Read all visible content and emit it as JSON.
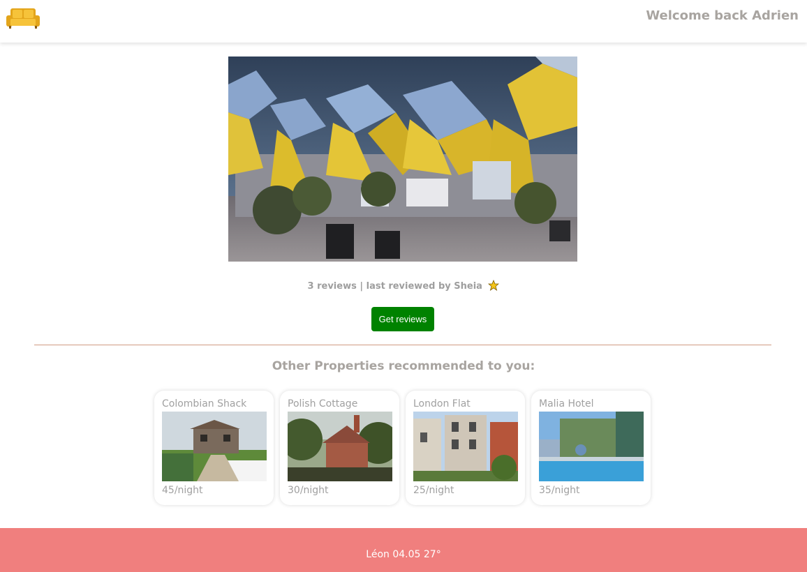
{
  "header": {
    "logo_icon": "sofa-icon",
    "welcome": "Welcome back Adrien"
  },
  "listing": {
    "reviews_text": "3 reviews | last reviewed by Sheia",
    "get_reviews_label": "Get reviews"
  },
  "recommendations": {
    "title": "Other Properties recommended to you:",
    "items": [
      {
        "name": "Colombian Shack",
        "price": "45/night"
      },
      {
        "name": "Polish Cottage",
        "price": "30/night"
      },
      {
        "name": "London Flat",
        "price": "25/night"
      },
      {
        "name": "Malia Hotel",
        "price": "35/night"
      }
    ]
  },
  "footer": {
    "text": "Léon 04.05 27°"
  },
  "colors": {
    "accent_green": "#008200",
    "footer": "#f07f7e",
    "divider": "#d09a82",
    "muted_text": "#a8a4a0"
  }
}
